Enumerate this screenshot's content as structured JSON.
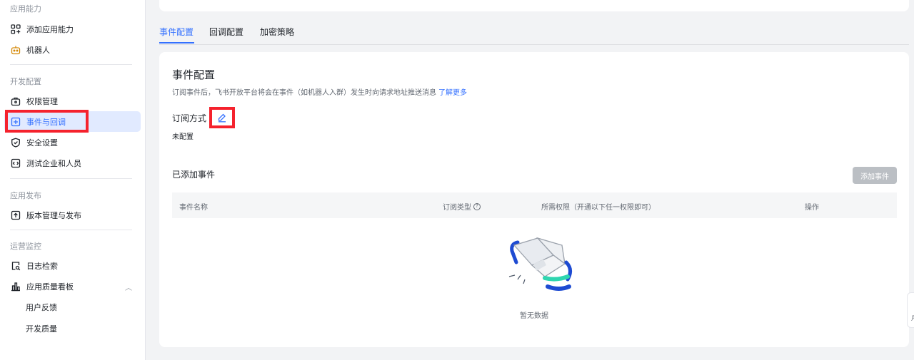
{
  "sidebar": {
    "sections": {
      "app_capability": "应用能力",
      "dev_config": "开发配置",
      "app_release": "应用发布",
      "ops_monitor": "运营监控"
    },
    "items": {
      "add_capability": "添加应用能力",
      "bot": "机器人",
      "permissions": "权限管理",
      "events_callbacks": "事件与回调",
      "security": "安全设置",
      "test_company": "测试企业和人员",
      "version": "版本管理与发布",
      "log_search": "日志检索",
      "quality_board": "应用质量看板",
      "user_feedback": "用户反馈",
      "dev_quality": "开发质量"
    },
    "active_item": "events_callbacks"
  },
  "tabs": [
    "事件配置",
    "回调配置",
    "加密策略"
  ],
  "active_tab": 0,
  "card": {
    "title": "事件配置",
    "description": "订阅事件后，飞书开放平台将会在事件（如机器人入群）发生时向请求地址推送消息",
    "learn_more": "了解更多",
    "subscription_label": "订阅方式",
    "subscription_value": "未配置",
    "added_events_title": "已添加事件",
    "add_event_button": "添加事件",
    "table_headers": {
      "event_name": "事件名称",
      "subscription_type": "订阅类型",
      "required_permissions": "所需权限（开通以下任一权限即可）",
      "actions": "操作"
    },
    "empty_text": "暂无数据"
  },
  "right_tab_text": "月",
  "colors": {
    "accent": "#3370ff",
    "highlight": "#f5222d",
    "disabled_button": "#bbbfc4"
  }
}
